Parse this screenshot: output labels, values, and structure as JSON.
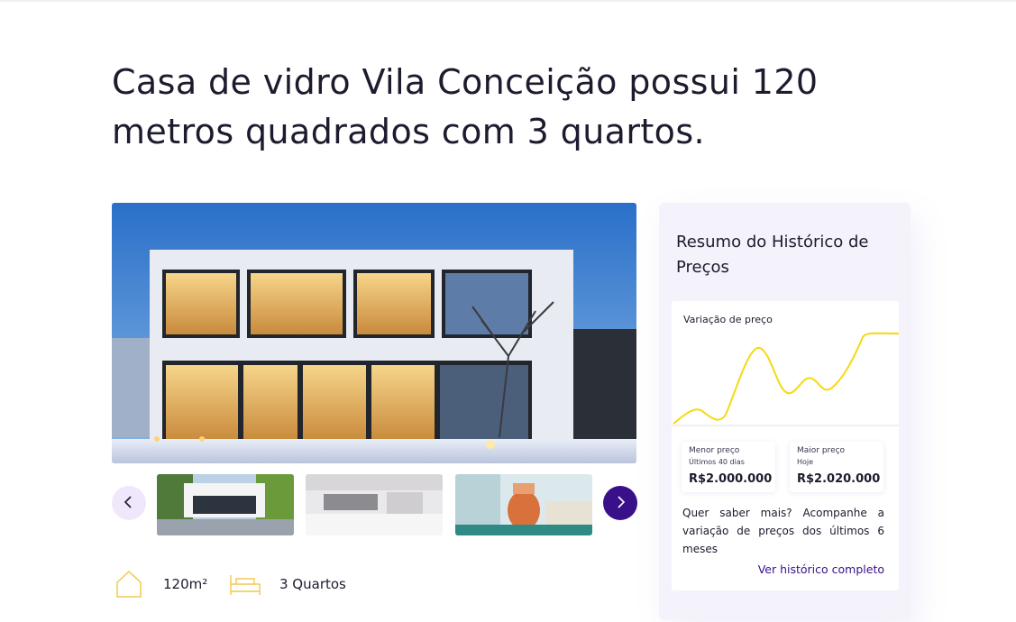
{
  "listing": {
    "title": "Casa de vidro Vila Conceição possui 120 metros quadrados com 3 quartos.",
    "hero_image": "modern-glass-house-night-photo",
    "thumbnails": [
      {
        "name": "house-exterior-pool-photo"
      },
      {
        "name": "white-kitchen-photo"
      },
      {
        "name": "decor-vase-interior-photo"
      }
    ],
    "carousel": {
      "prev_icon": "chevron-left-icon",
      "next_icon": "chevron-right-icon"
    },
    "features": {
      "area": {
        "icon": "house-outline-icon",
        "label": "120m²"
      },
      "rooms": {
        "icon": "bed-outline-icon",
        "label": "3 Quartos"
      }
    }
  },
  "price_history": {
    "title": "Resumo do Histórico de Preços",
    "chart_label": "Variação de preço",
    "lowest": {
      "label": "Menor preço",
      "sub": "Últimos 40 dias",
      "value": "R$2.000.000"
    },
    "highest": {
      "label": "Maior preço",
      "sub": "Hoje",
      "value": "R$2.020.000"
    },
    "info_text": "Quer saber mais? Acompanhe a variação de preços dos últimos 6 meses",
    "link_label": "Ver histórico completo"
  },
  "colors": {
    "accent": "#3a0f8a",
    "accent_light": "#efe7fb",
    "chart_line": "#f5d90f",
    "feature_icon": "#f2c94c"
  }
}
